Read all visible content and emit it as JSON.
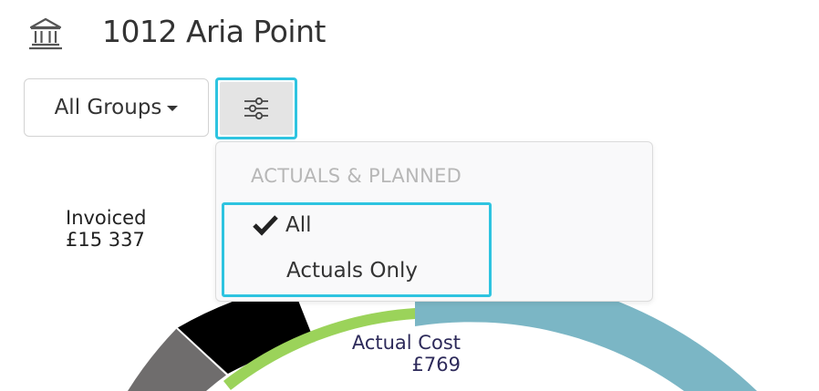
{
  "header": {
    "icon": "bank-icon",
    "title": "1012 Aria Point"
  },
  "toolbar": {
    "groups_label": "All Groups",
    "filter_icon": "sliders-icon"
  },
  "chart": {
    "invoiced_label": "Invoiced",
    "invoiced_value": "£15 337",
    "actual_cost_label": "Actual Cost",
    "actual_cost_value": "£769",
    "colors": {
      "teal": "#7bb6c5",
      "black": "#000000",
      "gray": "#6f6d6d",
      "green": "#9bd35a"
    }
  },
  "dropdown": {
    "header": "ACTUALS & PLANNED",
    "items": [
      {
        "label": "All",
        "selected": true
      },
      {
        "label": "Actuals Only",
        "selected": false
      }
    ]
  },
  "accent": "#2ec4e0"
}
